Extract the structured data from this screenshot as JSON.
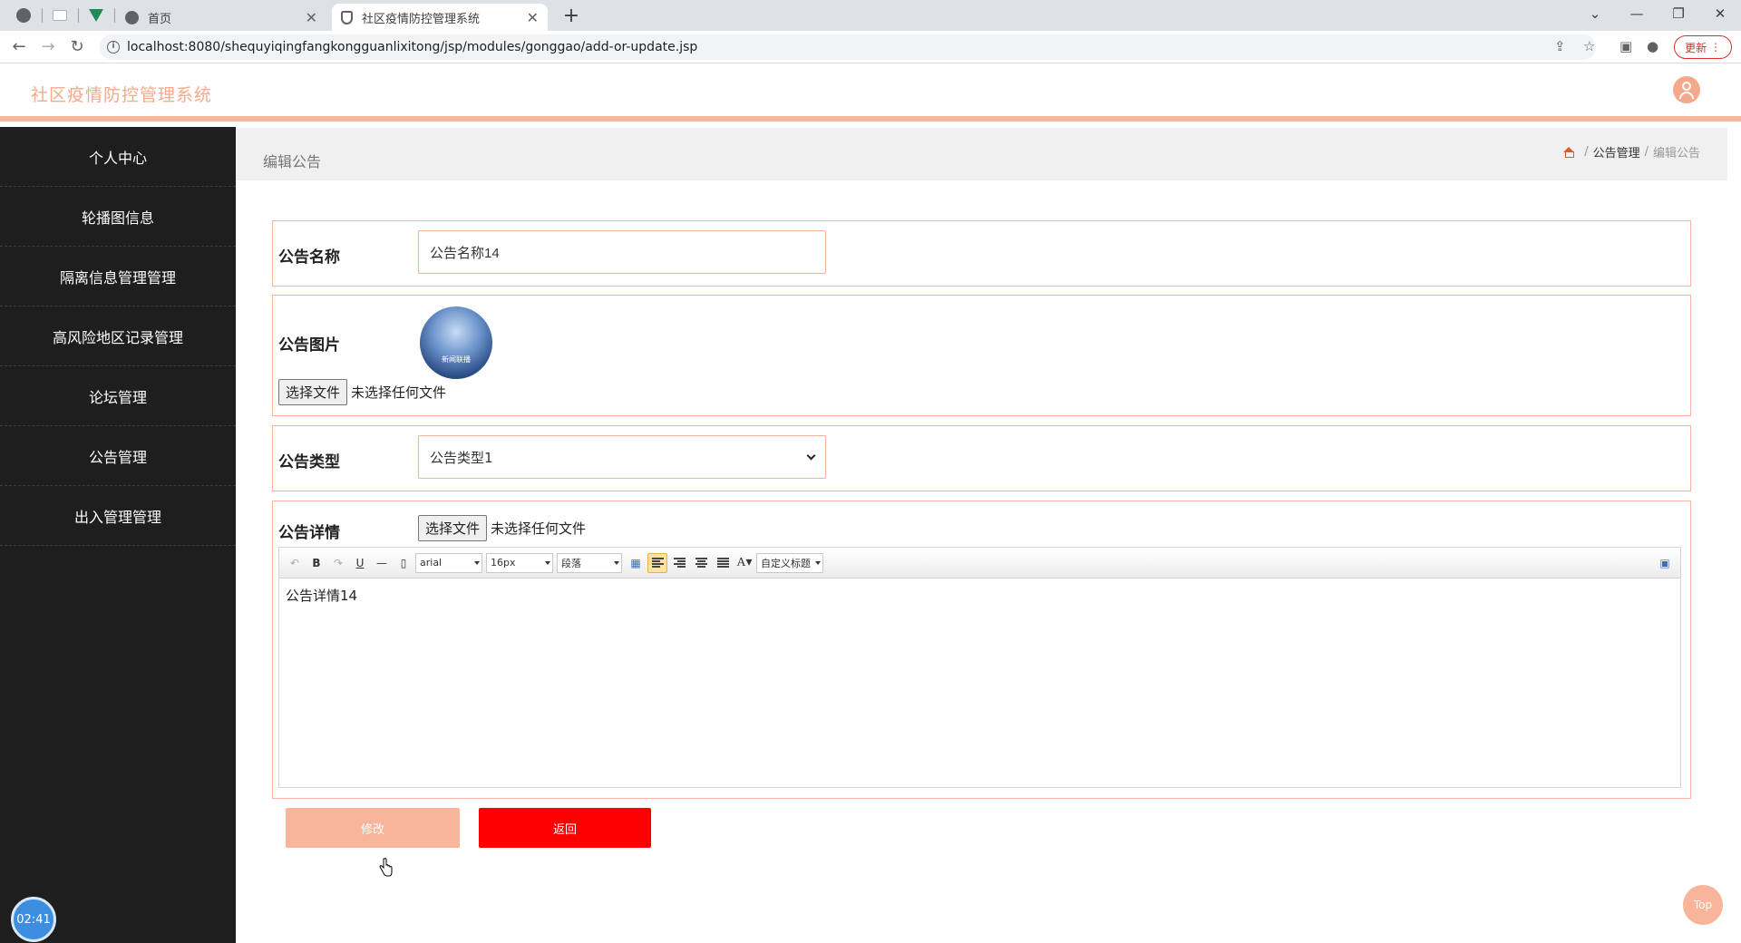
{
  "browser": {
    "tabs": [
      {
        "title": "首页"
      },
      {
        "title": "社区疫情防控管理系统"
      }
    ],
    "url": "localhost:8080/shequyiqingfangkongguanlixitong/jsp/modules/gonggao/add-or-update.jsp",
    "update_label": "更新"
  },
  "app": {
    "title": "社区疫情防控管理系统"
  },
  "sidebar": {
    "items": [
      {
        "label": "个人中心"
      },
      {
        "label": "轮播图信息"
      },
      {
        "label": "隔离信息管理管理"
      },
      {
        "label": "高风险地区记录管理"
      },
      {
        "label": "论坛管理"
      },
      {
        "label": "公告管理"
      },
      {
        "label": "出入管理管理"
      }
    ],
    "clock": "02:41"
  },
  "page": {
    "title": "编辑公告",
    "breadcrumb": {
      "parent": "公告管理",
      "current": "编辑公告"
    }
  },
  "form": {
    "name": {
      "label": "公告名称",
      "value": "公告名称14"
    },
    "image": {
      "label": "公告图片",
      "thumb_caption": "新闻联播",
      "file_button": "选择文件",
      "file_status": "未选择任何文件"
    },
    "type": {
      "label": "公告类型",
      "value": "公告类型1"
    },
    "detail": {
      "label": "公告详情",
      "file_button": "选择文件",
      "file_status": "未选择任何文件",
      "toolbar": {
        "font": "arial",
        "size": "16px",
        "paragraph": "段落",
        "custom_title": "自定义标题"
      },
      "content": "公告详情14"
    }
  },
  "actions": {
    "submit": "修改",
    "back": "返回",
    "top": "Top"
  },
  "colors": {
    "accent": "#f8b59b",
    "sidebar_bg": "#1e1e1e",
    "back_button": "#ff0000"
  }
}
